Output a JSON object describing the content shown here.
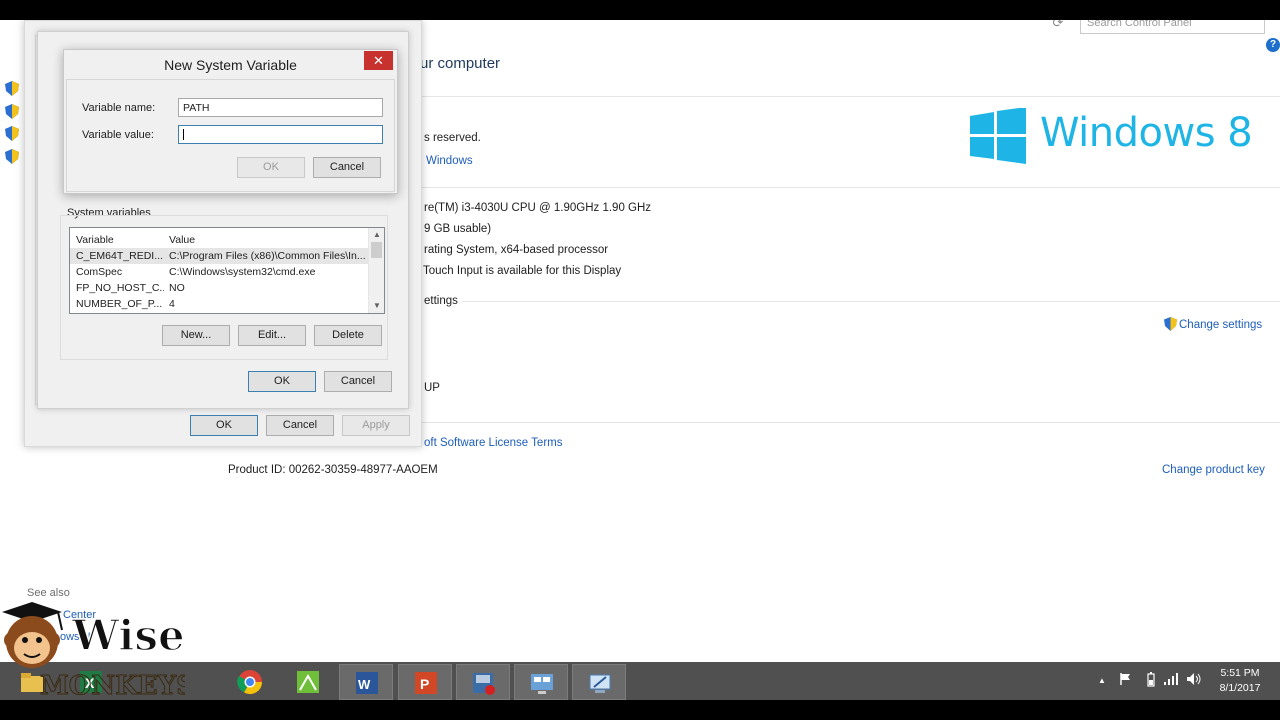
{
  "system": {
    "search_placeholder": "Search Control Panel",
    "heading": "ur computer",
    "rights": "s reserved.",
    "more_features_link": "Windows",
    "windows_logo_text": "Windows 8",
    "processor": "re(TM) i3-4030U CPU @ 1.90GHz   1.90 GHz",
    "ram": "9 GB usable)",
    "system_type": "rating System, x64-based processor",
    "pen_touch": "Touch Input is available for this Display",
    "section_settings": "ettings",
    "change_settings": "Change settings",
    "workgroup": "UP",
    "license_link": "oft Software License Terms",
    "product_id": "Product ID:  00262-30359-48977-AAOEM",
    "change_product_key": "Change product key"
  },
  "see_also": {
    "label": "See also",
    "link1": "Center",
    "link2": "ows U"
  },
  "environment_dialog": {
    "group_label": "System variables",
    "columns": [
      "Variable",
      "Value"
    ],
    "rows": [
      {
        "variable": "C_EM64T_REDI...",
        "value": "C:\\Program Files (x86)\\Common Files\\In..."
      },
      {
        "variable": "ComSpec",
        "value": "C:\\Windows\\system32\\cmd.exe"
      },
      {
        "variable": "FP_NO_HOST_C...",
        "value": "NO"
      },
      {
        "variable": "NUMBER_OF_P...",
        "value": "4"
      }
    ],
    "new_button": "New...",
    "edit_button": "Edit...",
    "delete_button": "Delete",
    "ok_button": "OK",
    "cancel_button": "Cancel"
  },
  "outer_dialog": {
    "ok_button": "OK",
    "cancel_button": "Cancel",
    "apply_button": "Apply"
  },
  "new_variable_dialog": {
    "title": "New System Variable",
    "close_glyph": "✕",
    "name_label": "Variable name:",
    "name_value": "PATH",
    "value_label": "Variable value:",
    "value_value": "",
    "ok_button": "OK",
    "cancel_button": "Cancel"
  },
  "watermark": {
    "line1": "Wise",
    "line2": "MONKEYS"
  },
  "taskbar": {
    "apps": [
      "file-explorer",
      "excel",
      "chrome",
      "notepad-plus",
      "word",
      "powerpoint",
      "media-player",
      "remote-desktop",
      "control-panel"
    ],
    "tray_up_glyph": "▲",
    "time": "5:51 PM",
    "date": "8/1/2017"
  },
  "colors": {
    "accent": "#1e5eb8",
    "windows_logo": "#1eb5e6",
    "close_button": "#c7312e",
    "taskbar": "#505050"
  }
}
